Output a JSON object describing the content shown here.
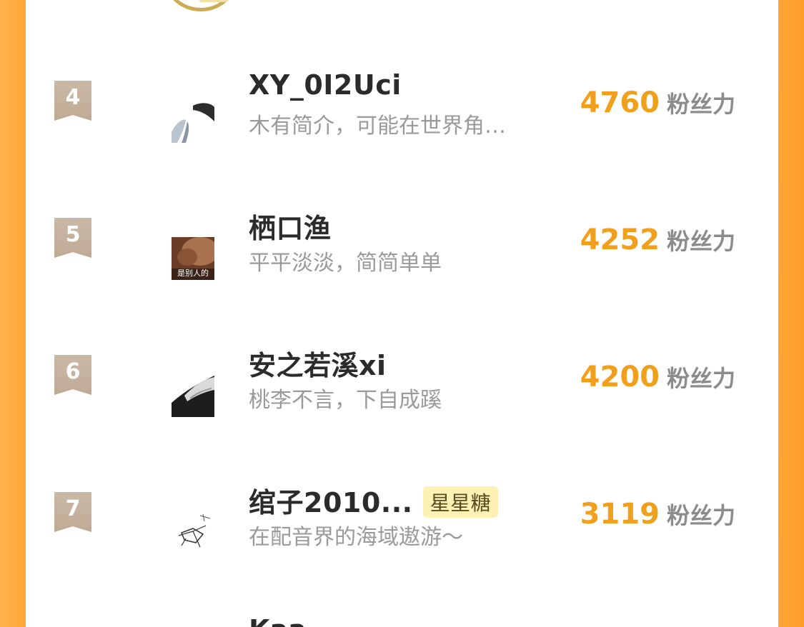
{
  "leaderboard": {
    "unit_label": "粉丝力",
    "entries": [
      {
        "rank": "4",
        "name": "XY_0I2Uci",
        "bio": "木有简介，可能在世界角…",
        "score": "4760",
        "badge": ""
      },
      {
        "rank": "5",
        "name": "栖口渔",
        "bio": "平平淡淡，简简单单",
        "score": "4252",
        "badge": "",
        "avatar_caption": "是别人的"
      },
      {
        "rank": "6",
        "name": "安之若溪xi",
        "bio": "桃李不言，下自成蹊",
        "score": "4200",
        "badge": ""
      },
      {
        "rank": "7",
        "name": "绾子2010...",
        "bio": "在配音界的海域遨游～",
        "score": "3119",
        "badge": "星星糖"
      }
    ],
    "next_partial_name": "Kaa..."
  },
  "colors": {
    "background": "#ffa533",
    "score": "#f0a01c",
    "rank_badge": "#c4ae99",
    "badge_bg": "#fdf1b4"
  }
}
